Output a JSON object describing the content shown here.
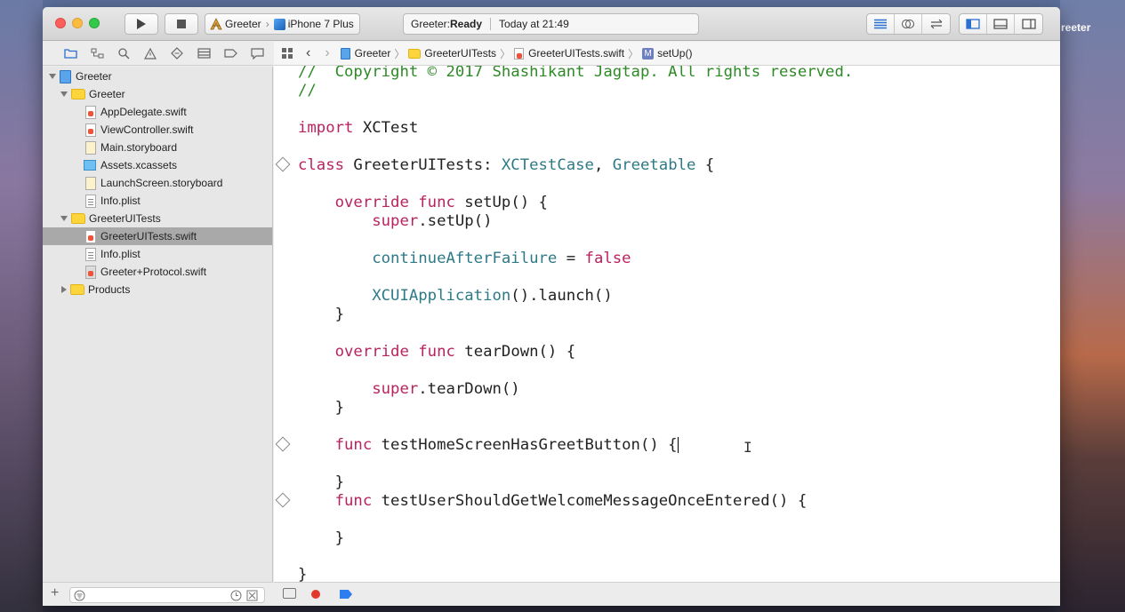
{
  "desktop": {
    "label": "reeter"
  },
  "toolbar": {
    "scheme_target": "Greeter",
    "scheme_device": "iPhone 7 Plus",
    "activity_prefix": "Greeter: ",
    "activity_status": "Ready",
    "activity_time": "Today at 21:49"
  },
  "navigator": {
    "items": [
      {
        "label": "Greeter",
        "kind": "project"
      },
      {
        "label": "Greeter",
        "kind": "folder"
      },
      {
        "label": "AppDelegate.swift",
        "kind": "swift"
      },
      {
        "label": "ViewController.swift",
        "kind": "swift"
      },
      {
        "label": "Main.storyboard",
        "kind": "storyboard"
      },
      {
        "label": "Assets.xcassets",
        "kind": "assets"
      },
      {
        "label": "LaunchScreen.storyboard",
        "kind": "storyboard"
      },
      {
        "label": "Info.plist",
        "kind": "plist"
      },
      {
        "label": "GreeterUITests",
        "kind": "folder"
      },
      {
        "label": "GreeterUITests.swift",
        "kind": "swift"
      },
      {
        "label": "Info.plist",
        "kind": "plist"
      },
      {
        "label": "Greeter+Protocol.swift",
        "kind": "swift"
      },
      {
        "label": "Products",
        "kind": "folder"
      }
    ],
    "selected": "GreeterUITests.swift"
  },
  "jumpbar": {
    "crumbs": [
      "Greeter",
      "GreeterUITests",
      "GreeterUITests.swift",
      "setUp()"
    ]
  },
  "editor": {
    "lines": {
      "l0": "//  Copyright © 2017 Shashikant Jagtap. All rights reserved.",
      "l1": "//",
      "l3a": "import",
      "l3b": " XCTest",
      "l5a": "class",
      "l5b": " GreeterUITests: ",
      "l5c": "XCTestCase",
      "l5d": ", ",
      "l5e": "Greetable",
      "l5f": " {",
      "l7a": "    override",
      "l7b": " ",
      "l7c": "func",
      "l7d": " setUp() {",
      "l8a": "        super",
      "l8b": ".setUp()",
      "l10a": "        continueAfterFailure",
      "l10b": " = ",
      "l10c": "false",
      "l12a": "        XCUIApplication",
      "l12b": "().launch()",
      "l13": "    }",
      "l15a": "    override",
      "l15b": " ",
      "l15c": "func",
      "l15d": " tearDown() {",
      "l17a": "        super",
      "l17b": ".tearDown()",
      "l18": "    }",
      "l20a": "    func",
      "l20b": " testHomeScreenHasGreetButton() {",
      "l22": "    }",
      "l23a": "    func",
      "l23b": " testUserShouldGetWelcomeMessageOnceEntered() {",
      "l25": "    }",
      "l27": "}"
    }
  },
  "colors": {
    "keyword": "#b8235f",
    "type": "#2d7a86",
    "comment": "#2d8a26"
  }
}
